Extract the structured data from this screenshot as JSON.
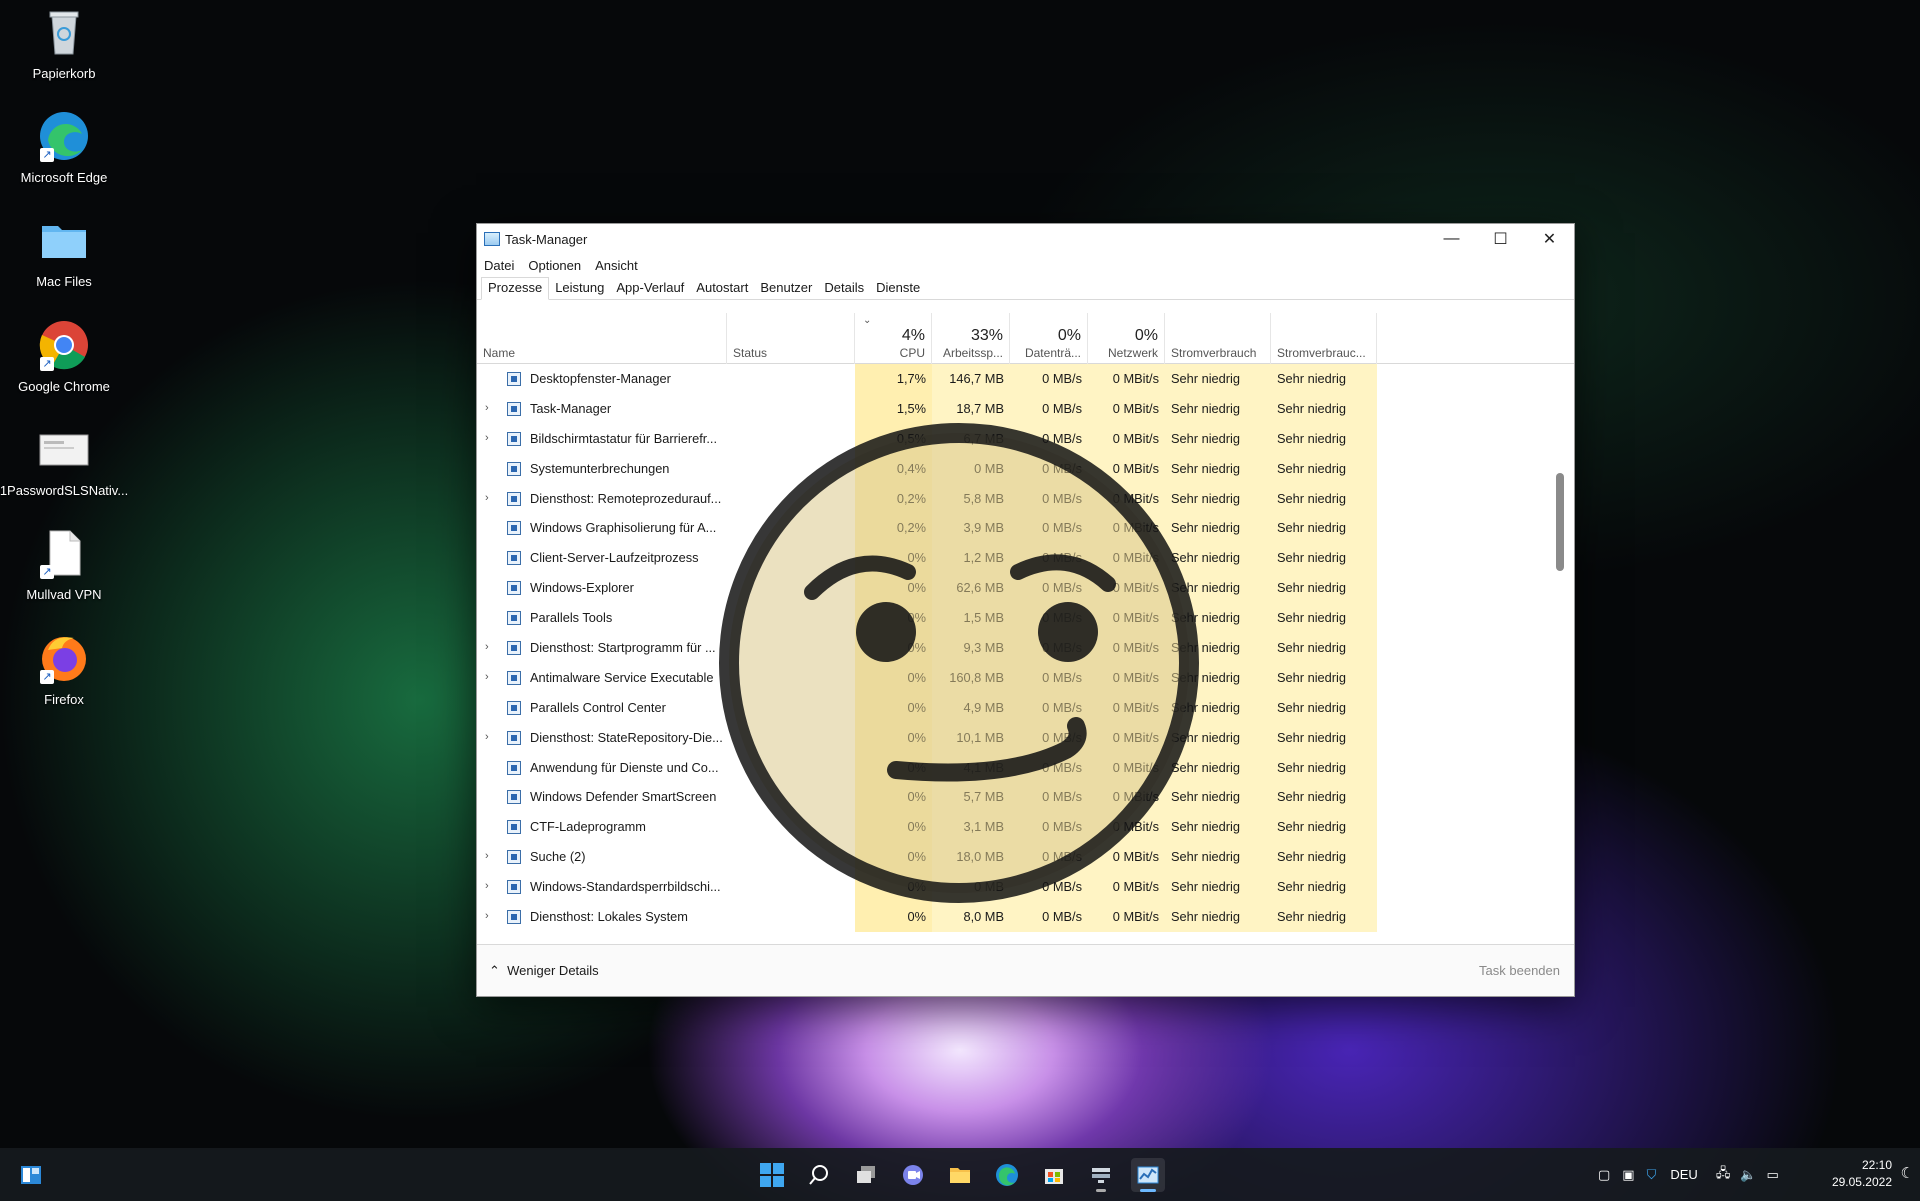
{
  "desktop": {
    "icons": [
      {
        "label": "Papierkorb",
        "icon": "recycle-bin-icon"
      },
      {
        "label": "Microsoft Edge",
        "icon": "edge-icon"
      },
      {
        "label": "Mac Files",
        "icon": "folder-icon"
      },
      {
        "label": "Google Chrome",
        "icon": "chrome-icon"
      },
      {
        "label": "1PasswordSLSNativ...",
        "icon": "file-preview-icon"
      },
      {
        "label": "Mullvad VPN",
        "icon": "document-icon"
      },
      {
        "label": "Firefox",
        "icon": "firefox-icon"
      }
    ]
  },
  "window": {
    "title": "Task-Manager",
    "controls": {
      "minimize": "—",
      "maximize": "☐",
      "close": "✕"
    },
    "menu": [
      "Datei",
      "Optionen",
      "Ansicht"
    ],
    "tabs": [
      "Prozesse",
      "Leistung",
      "App-Verlauf",
      "Autostart",
      "Benutzer",
      "Details",
      "Dienste"
    ],
    "active_tab": "Prozesse"
  },
  "table": {
    "sort_indicator": "⌄",
    "headers": {
      "name": "Name",
      "status": "Status",
      "cpu_pct": "4%",
      "cpu": "CPU",
      "mem_pct": "33%",
      "mem": "Arbeitssp...",
      "disk_pct": "0%",
      "disk": "Datenträ...",
      "net_pct": "0%",
      "net": "Netzwerk",
      "power": "Stromverbrauch",
      "power_trend": "Stromverbrauc..."
    },
    "rows": [
      {
        "expand": "",
        "name": "Desktopfenster-Manager",
        "cpu": "1,7%",
        "mem": "146,7 MB",
        "disk": "0 MB/s",
        "net": "0 MBit/s",
        "power": "Sehr niedrig",
        "trend": "Sehr niedrig"
      },
      {
        "expand": "›",
        "name": "Task-Manager",
        "cpu": "1,5%",
        "mem": "18,7 MB",
        "disk": "0 MB/s",
        "net": "0 MBit/s",
        "power": "Sehr niedrig",
        "trend": "Sehr niedrig"
      },
      {
        "expand": "›",
        "name": "Bildschirmtastatur für Barrierefr...",
        "cpu": "0,5%",
        "mem": "6,7 MB",
        "disk": "0 MB/s",
        "net": "0 MBit/s",
        "power": "Sehr niedrig",
        "trend": "Sehr niedrig"
      },
      {
        "expand": "",
        "name": "Systemunterbrechungen",
        "cpu": "0,4%",
        "mem": "0 MB",
        "disk": "0 MB/s",
        "net": "0 MBit/s",
        "power": "Sehr niedrig",
        "trend": "Sehr niedrig"
      },
      {
        "expand": "›",
        "name": "Diensthost: Remoteprozedurauf...",
        "cpu": "0,2%",
        "mem": "5,8 MB",
        "disk": "0 MB/s",
        "net": "0 MBit/s",
        "power": "Sehr niedrig",
        "trend": "Sehr niedrig"
      },
      {
        "expand": "",
        "name": "Windows Graphisolierung für A...",
        "cpu": "0,2%",
        "mem": "3,9 MB",
        "disk": "0 MB/s",
        "net": "0 MBit/s",
        "power": "Sehr niedrig",
        "trend": "Sehr niedrig"
      },
      {
        "expand": "",
        "name": "Client-Server-Laufzeitprozess",
        "cpu": "0%",
        "mem": "1,2 MB",
        "disk": "0 MB/s",
        "net": "0 MBit/s",
        "power": "Sehr niedrig",
        "trend": "Sehr niedrig"
      },
      {
        "expand": "",
        "name": "Windows-Explorer",
        "cpu": "0%",
        "mem": "62,6 MB",
        "disk": "0 MB/s",
        "net": "0 MBit/s",
        "power": "Sehr niedrig",
        "trend": "Sehr niedrig"
      },
      {
        "expand": "",
        "name": "Parallels Tools",
        "cpu": "0%",
        "mem": "1,5 MB",
        "disk": "0 MB/s",
        "net": "0 MBit/s",
        "power": "Sehr niedrig",
        "trend": "Sehr niedrig"
      },
      {
        "expand": "›",
        "name": "Diensthost: Startprogramm für ...",
        "cpu": "0%",
        "mem": "9,3 MB",
        "disk": "0 MB/s",
        "net": "0 MBit/s",
        "power": "Sehr niedrig",
        "trend": "Sehr niedrig"
      },
      {
        "expand": "›",
        "name": "Antimalware Service Executable",
        "cpu": "0%",
        "mem": "160,8 MB",
        "disk": "0 MB/s",
        "net": "0 MBit/s",
        "power": "Sehr niedrig",
        "trend": "Sehr niedrig"
      },
      {
        "expand": "",
        "name": "Parallels Control Center",
        "cpu": "0%",
        "mem": "4,9 MB",
        "disk": "0 MB/s",
        "net": "0 MBit/s",
        "power": "Sehr niedrig",
        "trend": "Sehr niedrig"
      },
      {
        "expand": "›",
        "name": "Diensthost: StateRepository-Die...",
        "cpu": "0%",
        "mem": "10,1 MB",
        "disk": "0 MB/s",
        "net": "0 MBit/s",
        "power": "Sehr niedrig",
        "trend": "Sehr niedrig"
      },
      {
        "expand": "",
        "name": "Anwendung für Dienste und Co...",
        "cpu": "0%",
        "mem": "4,1 MB",
        "disk": "0 MB/s",
        "net": "0 MBit/s",
        "power": "Sehr niedrig",
        "trend": "Sehr niedrig"
      },
      {
        "expand": "",
        "name": "Windows Defender SmartScreen",
        "cpu": "0%",
        "mem": "5,7 MB",
        "disk": "0 MB/s",
        "net": "0 MBit/s",
        "power": "Sehr niedrig",
        "trend": "Sehr niedrig"
      },
      {
        "expand": "",
        "name": "CTF-Ladeprogramm",
        "cpu": "0%",
        "mem": "3,1 MB",
        "disk": "0 MB/s",
        "net": "0 MBit/s",
        "power": "Sehr niedrig",
        "trend": "Sehr niedrig"
      },
      {
        "expand": "›",
        "name": "Suche (2)",
        "cpu": "0%",
        "mem": "18,0 MB",
        "disk": "0 MB/s",
        "net": "0 MBit/s",
        "power": "Sehr niedrig",
        "trend": "Sehr niedrig"
      },
      {
        "expand": "›",
        "name": "Windows-Standardsperrbildschi...",
        "cpu": "0%",
        "mem": "0 MB",
        "disk": "0 MB/s",
        "net": "0 MBit/s",
        "power": "Sehr niedrig",
        "trend": "Sehr niedrig"
      },
      {
        "expand": "›",
        "name": "Diensthost: Lokales System",
        "cpu": "0%",
        "mem": "8,0 MB",
        "disk": "0 MB/s",
        "net": "0 MBit/s",
        "power": "Sehr niedrig",
        "trend": "Sehr niedrig"
      }
    ]
  },
  "footer": {
    "less_details": "Weniger Details",
    "less_arrow": "⌃",
    "end_task": "Task beenden"
  },
  "taskbar": {
    "language": "DEU",
    "time": "22:10",
    "date": "29.05.2022"
  },
  "colors": {
    "cpu_highlight": "#fff4c4",
    "mem_highlight": "#ffefb0",
    "accent": "#0078d4",
    "overlay_face": "#e6d8a8"
  }
}
